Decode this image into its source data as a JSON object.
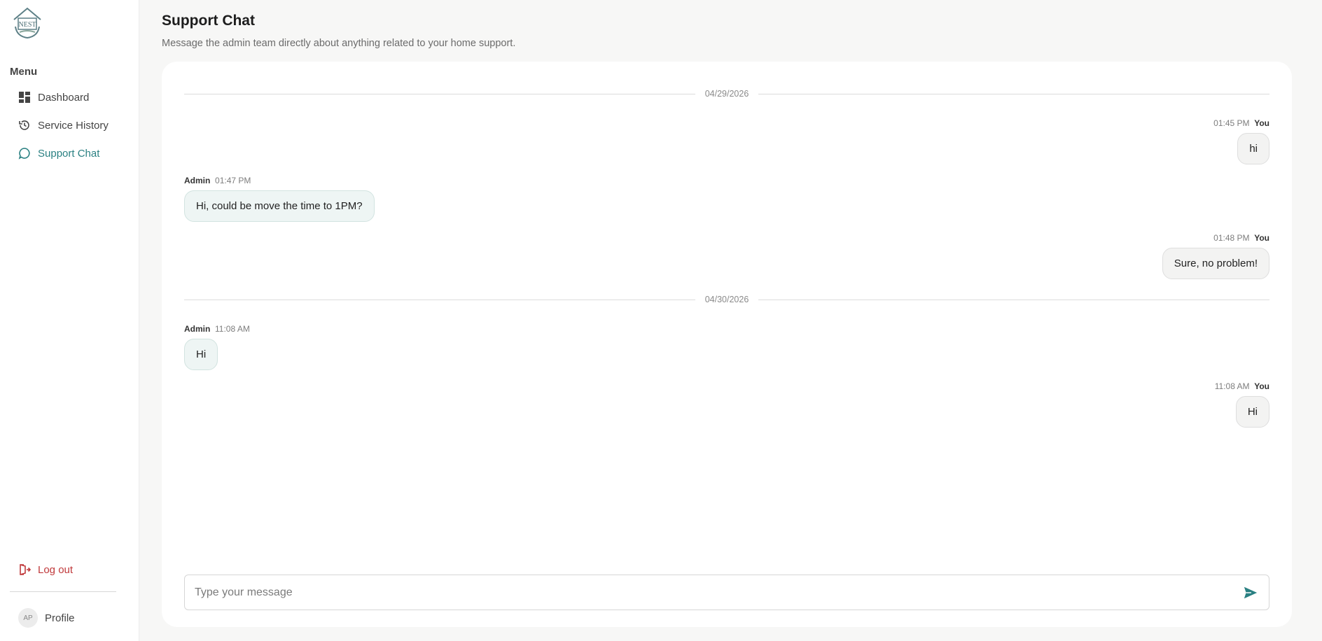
{
  "brand": {
    "logo_text": "NEST"
  },
  "sidebar": {
    "menu_title": "Menu",
    "items": [
      {
        "label": "Dashboard",
        "icon": "dashboard-icon"
      },
      {
        "label": "Service History",
        "icon": "history-icon"
      },
      {
        "label": "Support Chat",
        "icon": "chat-bubble-icon",
        "active": true
      }
    ],
    "logout_label": "Log out",
    "profile": {
      "initials": "AP",
      "label": "Profile"
    }
  },
  "page": {
    "title": "Support Chat",
    "subtitle": "Message the admin team directly about anything related to your home support."
  },
  "chat": {
    "dates": [
      "04/29/2026",
      "04/30/2026"
    ],
    "messages": [
      {
        "sender": "You",
        "time": "01:45 PM",
        "text": "hi"
      },
      {
        "sender": "Admin",
        "time": "01:47 PM",
        "text": "Hi, could be move the time to 1PM?"
      },
      {
        "sender": "You",
        "time": "01:48 PM",
        "text": "Sure, no problem!"
      },
      {
        "sender": "Admin",
        "time": "11:08 AM",
        "text": "Hi"
      },
      {
        "sender": "You",
        "time": "11:08 AM",
        "text": "Hi"
      }
    ]
  },
  "composer": {
    "placeholder": "Type your message",
    "value": ""
  },
  "colors": {
    "accent": "#2a8082",
    "danger": "#c0393b"
  }
}
